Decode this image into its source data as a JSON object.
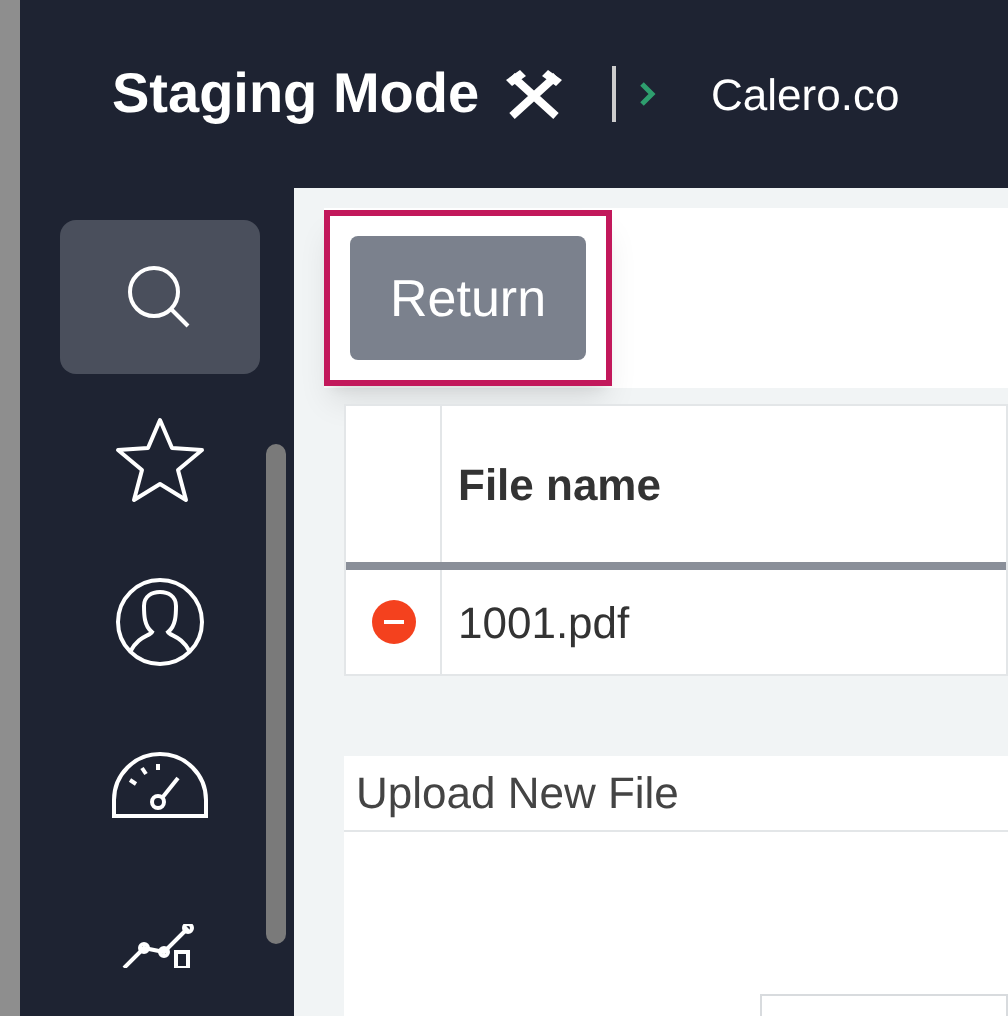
{
  "header": {
    "title": "Staging Mode",
    "breadcrumb": "Calero.co"
  },
  "sidebar": {
    "items": [
      {
        "kind": "search",
        "selected": true
      },
      {
        "kind": "star",
        "selected": false
      },
      {
        "kind": "user",
        "selected": false
      },
      {
        "kind": "gauge",
        "selected": false
      },
      {
        "kind": "chart",
        "selected": false
      }
    ]
  },
  "return_button": {
    "label": "Return",
    "highlighted": true
  },
  "table": {
    "columns": [
      "File name"
    ],
    "rows": [
      {
        "removable": true,
        "file": "1001.pdf"
      }
    ]
  },
  "upload": {
    "title": "Upload New File"
  }
}
